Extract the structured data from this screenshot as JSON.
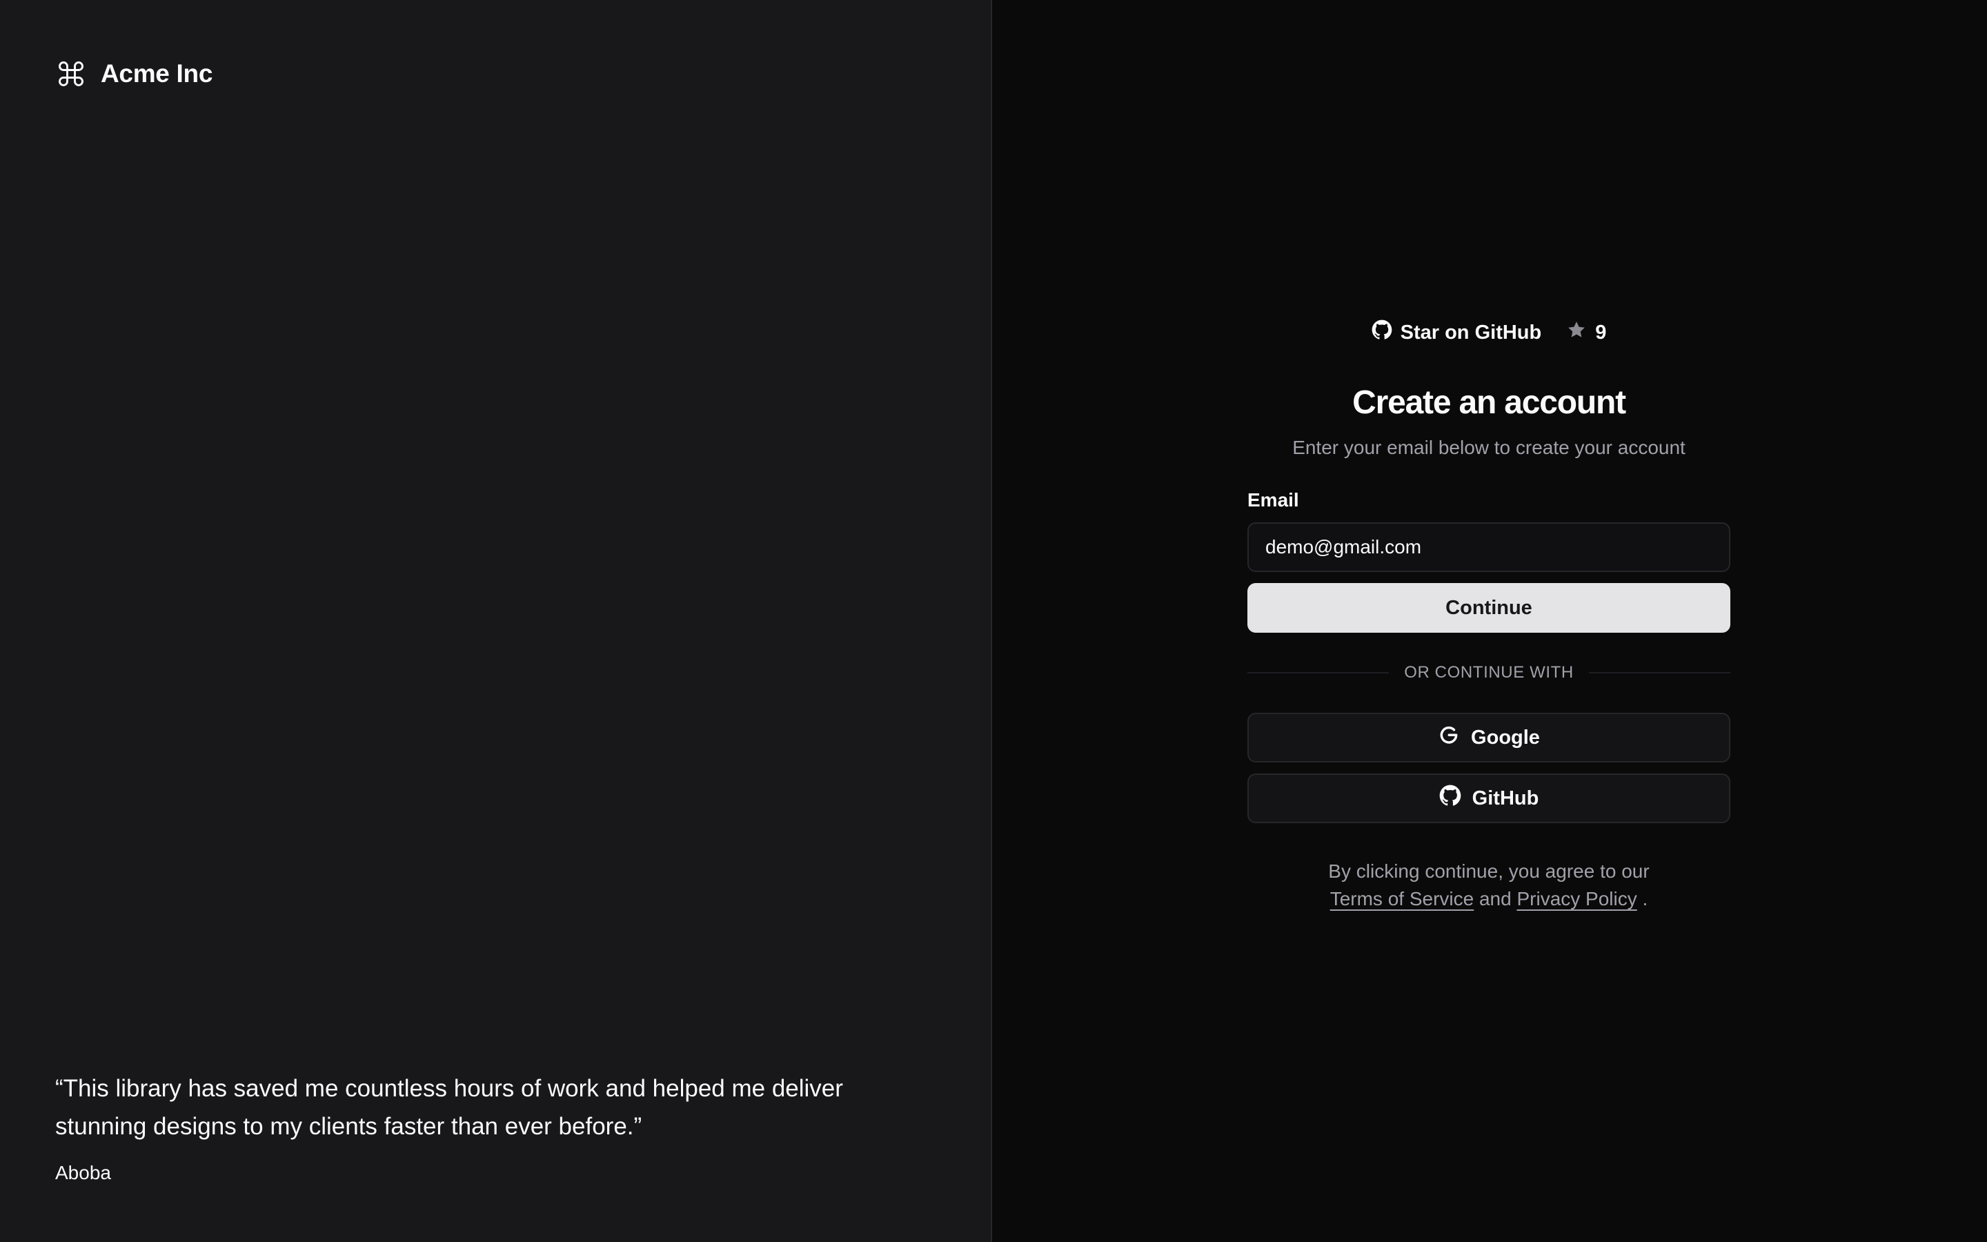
{
  "brand": {
    "name": "Acme Inc",
    "icon": "command-icon"
  },
  "testimonial": {
    "quote": "“This library has saved me countless hours of work and helped me deliver stunning designs to my clients faster than ever before.”",
    "author": "Aboba"
  },
  "github_star": {
    "label": "Star on GitHub",
    "count": "9",
    "icon": "github-icon",
    "star_icon": "star-icon"
  },
  "form": {
    "title": "Create an account",
    "subtitle": "Enter your email below to create your account",
    "email_label": "Email",
    "email_value": "demo@gmail.com",
    "continue_label": "Continue",
    "divider_text": "OR CONTINUE WITH",
    "google_label": "Google",
    "github_label": "GitHub"
  },
  "terms": {
    "prefix": "By clicking continue, you agree to our",
    "terms_link": "Terms of Service",
    "and": "and",
    "privacy_link": "Privacy Policy",
    "suffix": "."
  },
  "colors": {
    "left_bg": "#18181b",
    "right_bg": "#0a0a0a",
    "primary_button": "#e4e4e7",
    "muted_text": "#a1a1aa",
    "border": "#27272a"
  }
}
